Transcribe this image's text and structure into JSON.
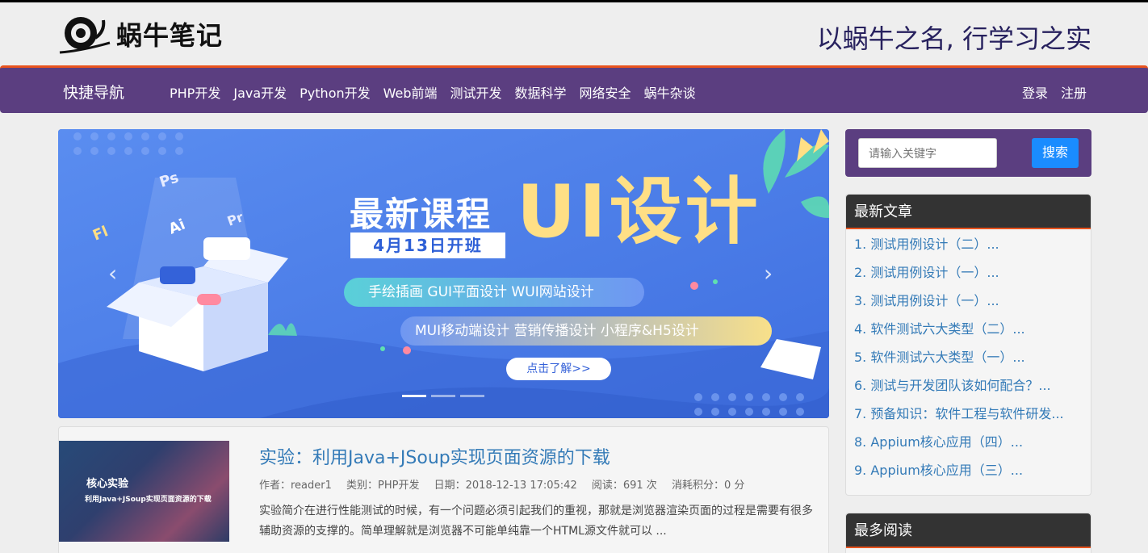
{
  "header": {
    "logo_text": "蜗牛笔记",
    "slogan": "以蜗牛之名, 行学习之实"
  },
  "nav": {
    "brand": "快捷导航",
    "items": [
      "PHP开发",
      "Java开发",
      "Python开发",
      "Web前端",
      "测试开发",
      "数据科学",
      "网络安全",
      "蜗牛杂谈"
    ],
    "login": "登录",
    "register": "注册"
  },
  "banner": {
    "title": "最新课程",
    "highlight": "UI设计",
    "date": "4月13日开班",
    "tags_line1": "手绘插画  GUI平面设计  WUI网站设计",
    "tags_line2": "MUI移动端设计  营销传播设计  小程序&H5设计",
    "cta": "点击了解>>",
    "tool_labels": [
      "Ps",
      "Ai",
      "Pr",
      "Fl"
    ],
    "slide_count": 3,
    "active_slide": 1
  },
  "article": {
    "thumb_title": "核心实验",
    "thumb_subtitle": "利用Java+JSoup实现页面资源的下载",
    "title": "实验：利用Java+JSoup实现页面资源的下载",
    "author": "作者：reader1",
    "category": "类别：PHP开发",
    "date": "日期：2018-12-13 17:05:42",
    "reads": "阅读：691 次",
    "points": "消耗积分：0 分",
    "desc": "实验简介在进行性能测试的时候，有一个问题必须引起我们的重视，那就是浏览器渲染页面的过程是需要有很多辅助资源的支撑的。简单理解就是浏览器不可能单纯靠一个HTML源文件就可以 ..."
  },
  "search": {
    "placeholder": "请输入关键字",
    "button": "搜索"
  },
  "latest": {
    "title": "最新文章",
    "items": [
      "1.  测试用例设计（二）...",
      "2.  测试用例设计（一）...",
      "3.  测试用例设计（一）...",
      "4.  软件测试六大类型（二）...",
      "5.  软件测试六大类型（一）...",
      "6.  测试与开发团队该如何配合？...",
      "7.  预备知识：软件工程与软件研发...",
      "8.  Appium核心应用（四）...",
      "9.  Appium核心应用（三）..."
    ]
  },
  "most_read": {
    "title": "最多阅读"
  }
}
